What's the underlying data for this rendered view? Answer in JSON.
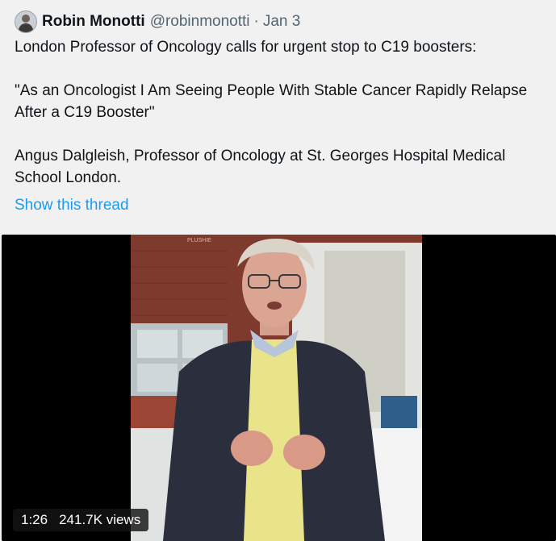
{
  "tweet": {
    "author": {
      "display_name": "Robin Monotti",
      "handle": "@robinmonotti",
      "separator": "·",
      "date": "Jan 3"
    },
    "text": {
      "line1": "London Professor of Oncology calls for urgent stop to C19 boosters:",
      "quote": "\"As an Oncologist I Am Seeing People With Stable Cancer Rapidly Relapse After a C19 Booster\"",
      "attribution": "Angus Dalgleish, Professor of Oncology at St. Georges Hospital Medical School London."
    },
    "show_thread_label": "Show this thread",
    "video": {
      "duration": "1:26",
      "views": "241.7K views",
      "watermark": "PLUSHIE"
    }
  },
  "colors": {
    "link": "#1d9bf0",
    "name": "#0f1419",
    "secondary": "#536471"
  },
  "icons": {
    "avatar": "profile-photo"
  }
}
